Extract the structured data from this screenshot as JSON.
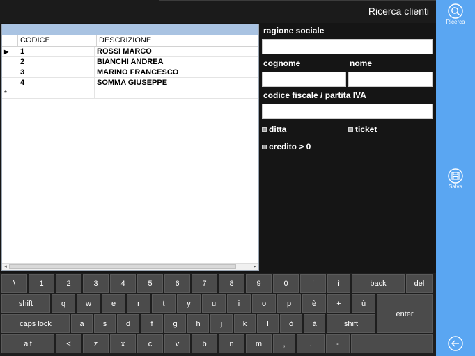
{
  "title": "Ricerca clienti",
  "side": {
    "search_label": "Ricerca",
    "save_label": "Salva"
  },
  "grid": {
    "columns": [
      "CODICE",
      "DESCRIZIONE"
    ],
    "rows": [
      {
        "code": "1",
        "desc": "ROSSI MARCO"
      },
      {
        "code": "2",
        "desc": "BIANCHI  ANDREA"
      },
      {
        "code": "3",
        "desc": "MARINO FRANCESCO"
      },
      {
        "code": "4",
        "desc": "SOMMA GIUSEPPE"
      }
    ],
    "current_row_marker": "▶",
    "new_row_marker": "*"
  },
  "form": {
    "ragione_label": "ragione sociale",
    "ragione_value": "",
    "cognome_label": "cognome",
    "cognome_value": "",
    "nome_label": "nome",
    "nome_value": "",
    "cf_label": "codice fiscale / partita IVA",
    "cf_value": "",
    "ditta_label": "ditta",
    "ticket_label": "ticket",
    "credito_label": "credito > 0"
  },
  "keyboard": {
    "row1": [
      "\\",
      "1",
      "2",
      "3",
      "4",
      "5",
      "6",
      "7",
      "8",
      "9",
      "0",
      "'",
      "ì",
      "back",
      "del"
    ],
    "row2": [
      "shift",
      "q",
      "w",
      "e",
      "r",
      "t",
      "y",
      "u",
      "i",
      "o",
      "p",
      "è",
      "+",
      "ù",
      "enter"
    ],
    "row3": [
      "caps lock",
      "a",
      "s",
      "d",
      "f",
      "g",
      "h",
      "j",
      "k",
      "l",
      "ò",
      "à",
      "shift"
    ],
    "row4": [
      "alt",
      "<",
      "z",
      "x",
      "c",
      "v",
      "b",
      "n",
      "m",
      ",",
      ".",
      "-",
      ""
    ]
  },
  "colors": {
    "accent": "#5aa6f2",
    "background": "#151515",
    "key": "#4b4b4b"
  }
}
